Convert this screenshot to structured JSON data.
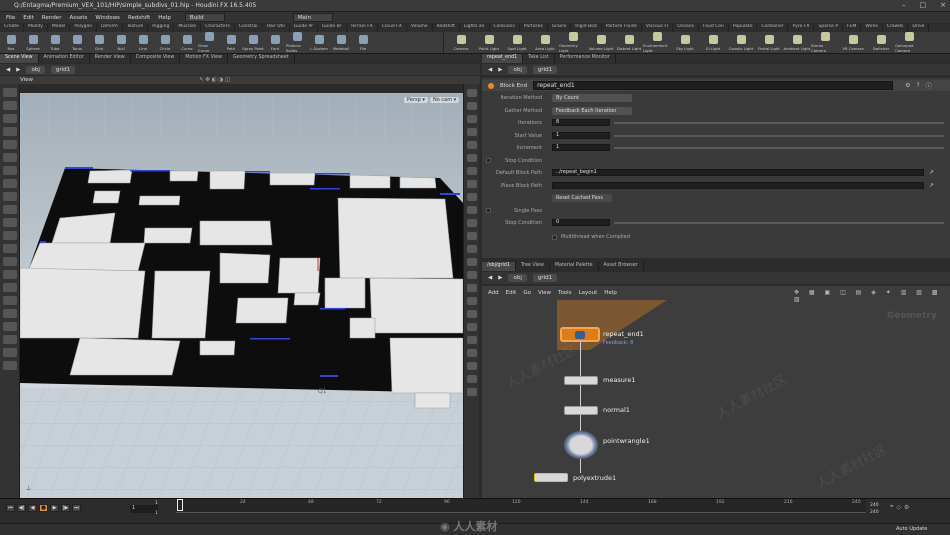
{
  "titlebar": {
    "title": "Q:/Entagma/Premium_VEX_101/HIP/simple_subdivs_01.hip - Houdini FX 16.5.405",
    "controls": [
      "–",
      "□",
      "×"
    ]
  },
  "menubar": {
    "items": [
      "File",
      "Edit",
      "Render",
      "Assets",
      "Windows",
      "Redshift",
      "Help"
    ],
    "desktop_build": "Build",
    "desktop_main": "Main"
  },
  "shelf_tabs": [
    "Create",
    "Modify",
    "Model",
    "Polygon",
    "Deform",
    "Texture",
    "Rigging",
    "Muscles",
    "Characters",
    "Constrai",
    "Hair Util",
    "Guide Pr",
    "Guide Br",
    "Terrain FX",
    "Cloud FX",
    "Volume",
    "Redshift",
    "Lights an",
    "Collisions",
    "Particles",
    "Grains",
    "Rigid Bod",
    "Particle Fluids",
    "Viscous Fl",
    "Oceans",
    "Fluid Con",
    "Populate",
    "Container",
    "Pyro FX",
    "Sparse P",
    "FEM",
    "Wires",
    "Crowds",
    "Drive"
  ],
  "shelf_tools": [
    "Box",
    "Sphere",
    "Tube",
    "Torus",
    "Grid",
    "Null",
    "Line",
    "Circle",
    "Curve",
    "Draw Curve",
    "Path",
    "Spray Paint",
    "Font",
    "Platonic Solids",
    "L-System",
    "Metaball",
    "File"
  ],
  "shelf_tools_right": [
    "Camera",
    "Point Light",
    "Spot Light",
    "Area Light",
    "Geometry Light",
    "Volume Light",
    "Distant Light",
    "Environment Light",
    "Sky Light",
    "GI Light",
    "Caustic Light",
    "Portal Light",
    "Ambient Light",
    "Stereo Camera",
    "VR Camera",
    "Switcher",
    "Gamepad Camera"
  ],
  "left_tabs": [
    "Scene View",
    "Animation Editor",
    "Render View",
    "Composite View",
    "Motion FX View",
    "Geometry Spreadsheet"
  ],
  "left_path": [
    "obj",
    "grid1"
  ],
  "viewport": {
    "label": "View",
    "persp": "Persp ▾",
    "nocam": "No cam ▾",
    "point_label": "Q1"
  },
  "right_tabs": [
    "repeat_end1",
    "Take List",
    "Performance Monitor"
  ],
  "right_path": [
    "obj",
    "grid1"
  ],
  "params": {
    "node_type": "Block End",
    "node_name": "repeat_end1",
    "rows": [
      {
        "label": "Iteration Method",
        "value": "By Count",
        "kind": "menu"
      },
      {
        "label": "Gather Method",
        "value": "Feedback Each Iteration",
        "kind": "menu"
      },
      {
        "label": "Iterations",
        "value": "8",
        "kind": "field"
      },
      {
        "label": "Start Value",
        "value": "1",
        "kind": "field"
      },
      {
        "label": "Increment",
        "value": "1",
        "kind": "field"
      },
      {
        "label": "Stop Condition",
        "value": "",
        "kind": "header"
      },
      {
        "label": "Default Block Path",
        "value": "../repeat_begin1",
        "kind": "path"
      },
      {
        "label": "Piece Block Path",
        "value": "",
        "kind": "path"
      },
      {
        "label": "",
        "value": "Reset Cached Pass",
        "kind": "button"
      },
      {
        "label": "Single Pass",
        "value": "",
        "kind": "header"
      },
      {
        "label": "Stop Condition",
        "value": "0",
        "kind": "field"
      }
    ],
    "multithread": "Multithread when Compiled"
  },
  "net_tabs": [
    "/obj/grid1",
    "Tree View",
    "Material Palette",
    "Asset Browser"
  ],
  "net_path": [
    "obj",
    "grid1"
  ],
  "net_menu": [
    "Add",
    "Edit",
    "Go",
    "View",
    "Tools",
    "Layout",
    "Help"
  ],
  "net_watermark": "Geometry",
  "nodes": [
    {
      "name": "repeat_end1",
      "sub": "Feedback: 8"
    },
    {
      "name": "measure1",
      "sub": ""
    },
    {
      "name": "normal1",
      "sub": ""
    },
    {
      "name": "pointwrangle1",
      "sub": ""
    },
    {
      "name": "polyextrude1",
      "sub": ""
    }
  ],
  "timeline": {
    "ticks": [
      "24",
      "48",
      "72",
      "96",
      "120",
      "144",
      "168",
      "192",
      "216",
      "240"
    ],
    "frame_start": "1",
    "frame_current": "1",
    "range_start": "1",
    "range_end": "1",
    "end_top": "240",
    "end_bottom": "240",
    "auto_update": "Auto Update"
  },
  "colors": {
    "accent": "#f08a1c",
    "node_selected": "#e07d12",
    "handle": "#ffffff"
  }
}
